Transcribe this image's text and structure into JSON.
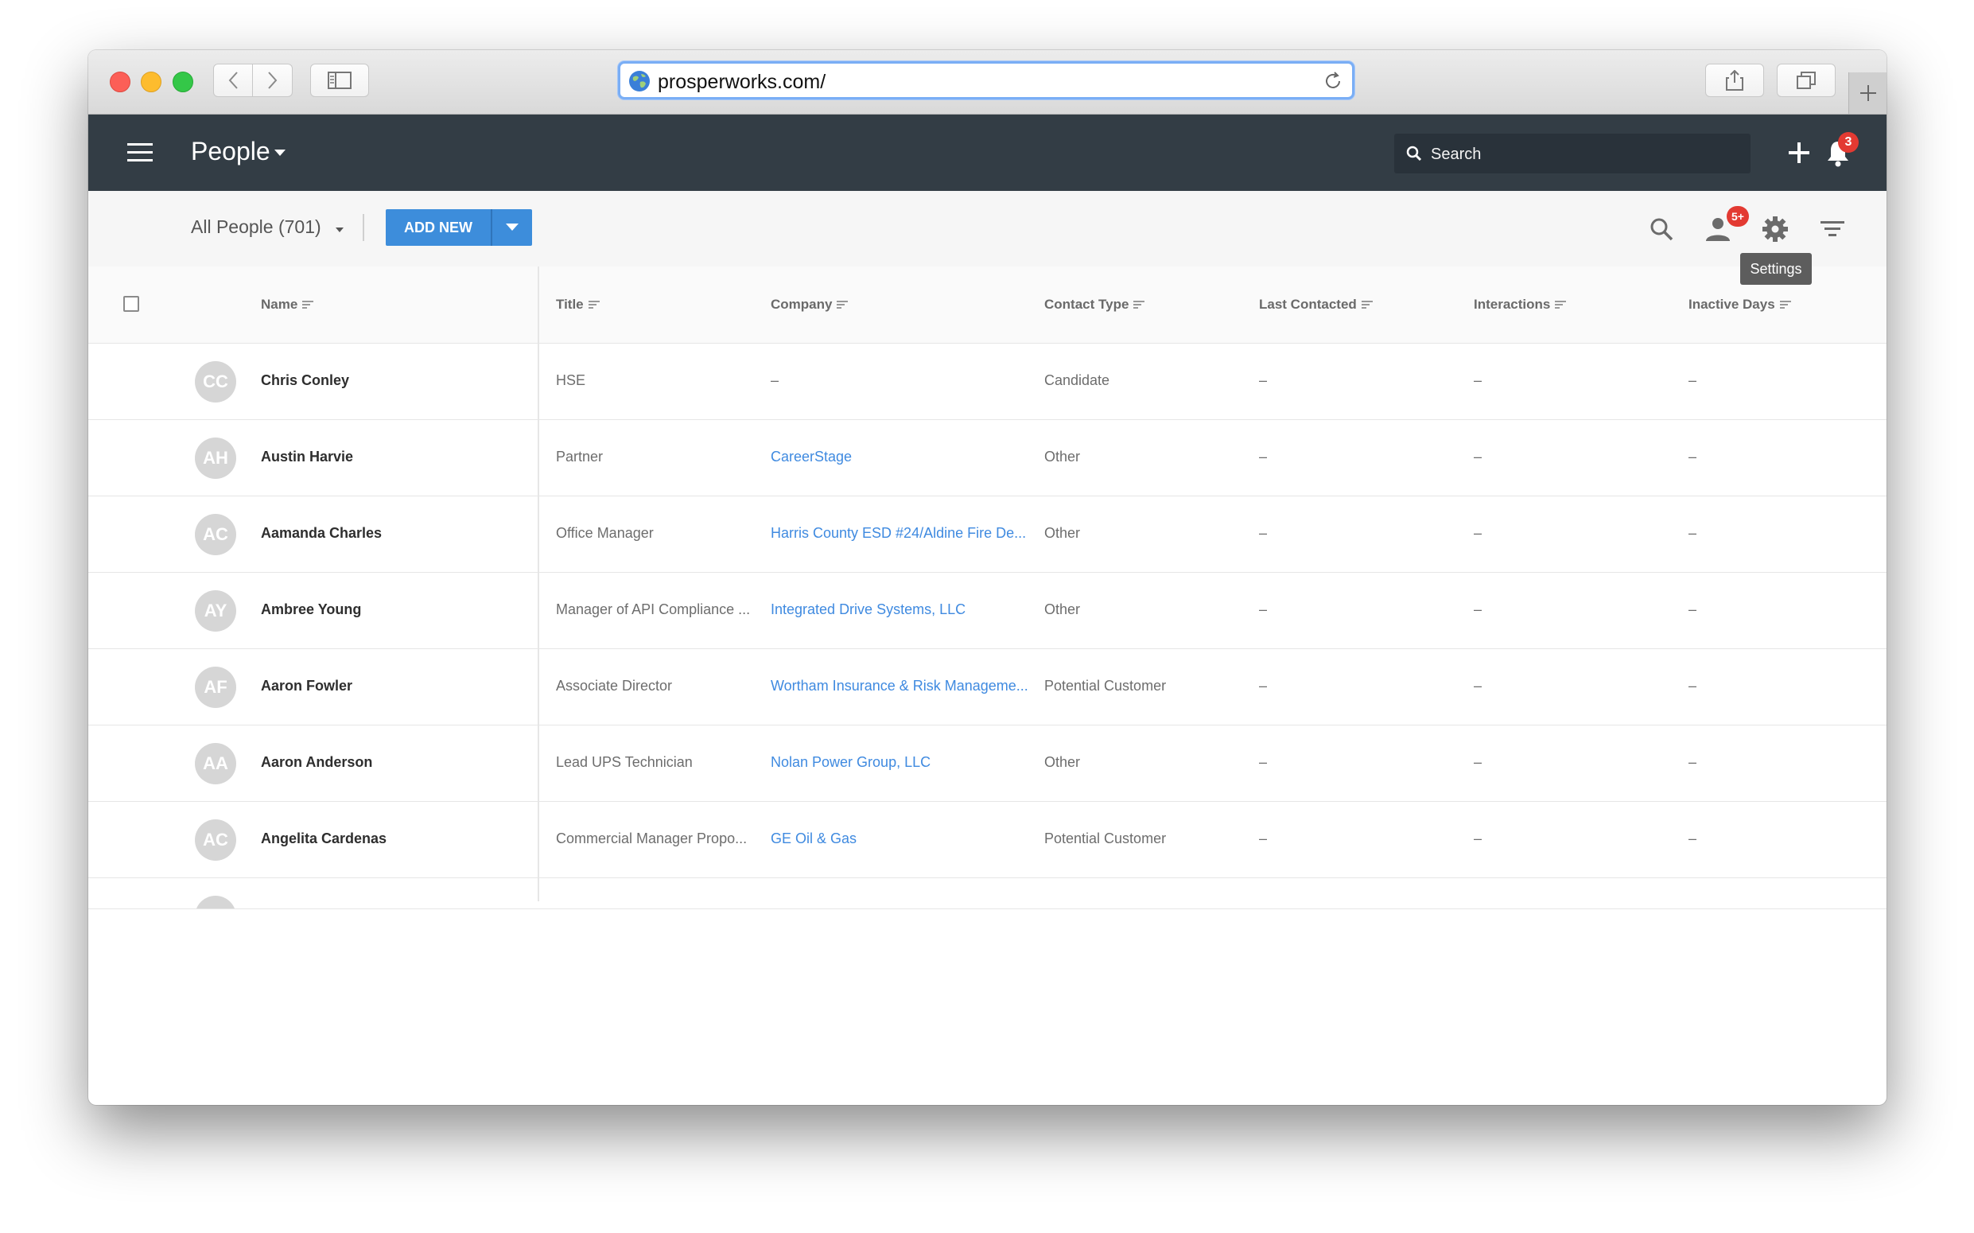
{
  "browser": {
    "url": "prosperworks.com/"
  },
  "header": {
    "title": "People",
    "search_placeholder": "Search",
    "notification_count": "3"
  },
  "toolbar": {
    "view_label": "All People (701)",
    "add_new_label": "ADD NEW",
    "person_badge": "5+",
    "tooltip": "Settings"
  },
  "table": {
    "columns": [
      "Name",
      "Title",
      "Company",
      "Contact Type",
      "Last Contacted",
      "Interactions",
      "Inactive Days"
    ],
    "rows": [
      {
        "initials": "CC",
        "name": "Chris Conley",
        "title": "HSE",
        "company": "–",
        "company_link": false,
        "type": "Candidate",
        "last": "–",
        "interactions": "–",
        "inactive": "–"
      },
      {
        "initials": "AH",
        "name": "Austin Harvie",
        "title": "Partner",
        "company": "CareerStage",
        "company_link": true,
        "type": "Other",
        "last": "–",
        "interactions": "–",
        "inactive": "–"
      },
      {
        "initials": "AC",
        "name": "Aamanda Charles",
        "title": "Office Manager",
        "company": "Harris County ESD #24/Aldine Fire De...",
        "company_link": true,
        "type": "Other",
        "last": "–",
        "interactions": "–",
        "inactive": "–"
      },
      {
        "initials": "AY",
        "name": "Ambree Young",
        "title": "Manager of API Compliance ...",
        "company": "Integrated Drive Systems, LLC",
        "company_link": true,
        "type": "Other",
        "last": "–",
        "interactions": "–",
        "inactive": "–"
      },
      {
        "initials": "AF",
        "name": "Aaron Fowler",
        "title": "Associate Director",
        "company": "Wortham Insurance & Risk Manageme...",
        "company_link": true,
        "type": "Potential Customer",
        "last": "–",
        "interactions": "–",
        "inactive": "–"
      },
      {
        "initials": "AA",
        "name": "Aaron Anderson",
        "title": "Lead UPS Technician",
        "company": "Nolan Power Group, LLC",
        "company_link": true,
        "type": "Other",
        "last": "–",
        "interactions": "–",
        "inactive": "–"
      },
      {
        "initials": "AC",
        "name": "Angelita Cardenas",
        "title": "Commercial Manager Propo...",
        "company": "GE Oil & Gas",
        "company_link": true,
        "type": "Potential Customer",
        "last": "–",
        "interactions": "–",
        "inactive": "–"
      }
    ]
  },
  "colors": {
    "app_header": "#333d45",
    "accent": "#3d8ddb",
    "link": "#3f8ae0",
    "badge": "#e33a32"
  }
}
